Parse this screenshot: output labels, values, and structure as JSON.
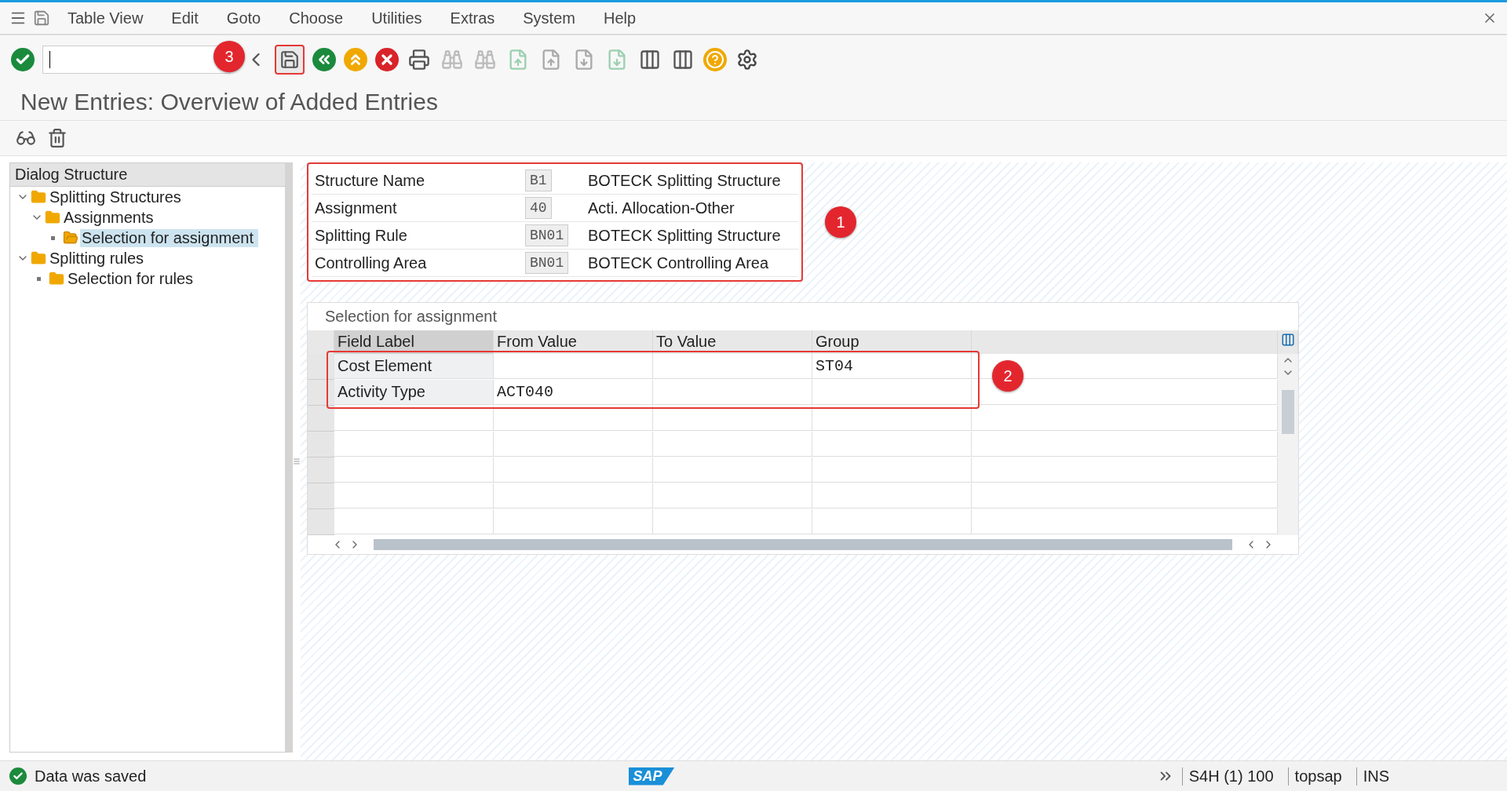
{
  "menu_bar": {
    "items": [
      "Table View",
      "Edit",
      "Goto",
      "Choose",
      "Utilities",
      "Extras",
      "System",
      "Help"
    ]
  },
  "title": "New Entries: Overview of Added Entries",
  "tree": {
    "title": "Dialog Structure",
    "items": [
      {
        "label": "Splitting Structures",
        "expanded": true,
        "selected": false,
        "children": [
          {
            "label": "Assignments",
            "expanded": true,
            "selected": false,
            "children": [
              {
                "label": "Selection for assignment",
                "selected": true
              }
            ]
          }
        ]
      },
      {
        "label": "Splitting rules",
        "expanded": true,
        "selected": false,
        "children": [
          {
            "label": "Selection for rules",
            "selected": false
          }
        ]
      }
    ]
  },
  "header_fields": [
    {
      "label": "Structure Name",
      "value": "B1",
      "description": "BOTECK  Splitting Structure"
    },
    {
      "label": "Assignment",
      "value": "40",
      "description": "Acti. Allocation-Other"
    },
    {
      "label": "Splitting Rule",
      "value": "BN01",
      "description": "BOTECK Splitting Structure"
    },
    {
      "label": "Controlling Area",
      "value": "BN01",
      "description": "BOTECK Controlling Area"
    }
  ],
  "table": {
    "title": "Selection for assignment",
    "columns": [
      "Field Label",
      "From Value",
      "To Value",
      "Group"
    ],
    "rows": [
      {
        "field_label": "Cost Element",
        "group": "ST04"
      },
      {
        "field_label": "Activity Type",
        "from_value": "ACT040"
      }
    ]
  },
  "callouts": [
    "1",
    "2",
    "3"
  ],
  "status_bar": {
    "message": "Data was saved",
    "logo": "SAP",
    "system": "S4H (1) 100",
    "user": "topsap",
    "mode": "INS"
  }
}
